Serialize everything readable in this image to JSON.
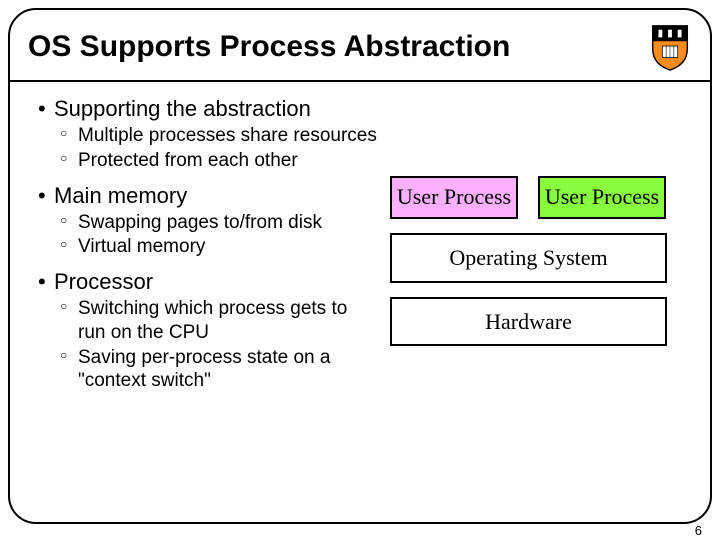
{
  "title": "OS Supports Process Abstraction",
  "sections": [
    {
      "head": "Supporting the abstraction",
      "items": [
        "Multiple processes share resources",
        "Protected from each other"
      ]
    },
    {
      "head": "Main memory",
      "items": [
        "Swapping pages to/from disk",
        "Virtual memory"
      ]
    },
    {
      "head": "Processor",
      "items": [
        "Switching which process gets to run on the CPU",
        "Saving per-process state on a \"context switch\""
      ]
    }
  ],
  "diagram": {
    "user1": "User Process",
    "user2": "User Process",
    "os": "Operating System",
    "hw": "Hardware"
  },
  "page_number": "6"
}
